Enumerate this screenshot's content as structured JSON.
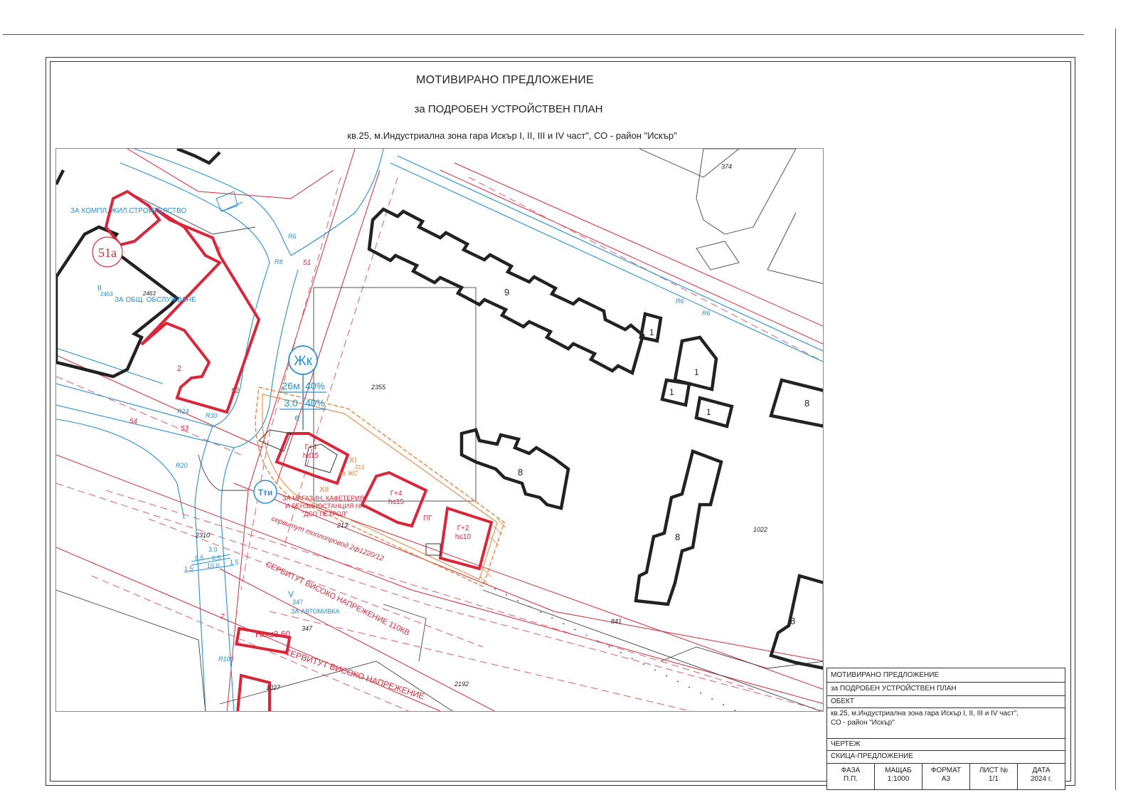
{
  "document": {
    "title": "МОТИВИРАНО ПРЕДЛОЖЕНИЕ",
    "subtitle": "за ПОДРОБЕН УСТРОЙСТВЕН ПЛАН",
    "location": "кв.25, м.Индустриална зона гара Искър I, II, III и IV част\", СО - район \"Искър\""
  },
  "map": {
    "zone_code": "Жк",
    "zone_height": "26м",
    "zone_density1": "40%",
    "zone_ratio": "3.0",
    "zone_density2": "40%",
    "zone_extra": "е",
    "tech_zone": "Тти",
    "quarter_number": "51а",
    "upi_purpose_construction": "ЗА КОМПЛ. ЖИЛ.СТРОИТЕЛСТВО",
    "upi_purpose_service": "ЗА ОБЩ. ОБСЛУЖВАНЕ",
    "upi_roman_2": "II",
    "upi_roman_2_ref": "2463",
    "upi_roman_5": "V",
    "upi_roman_5_ref": "347",
    "upi_purpose_carwash": "ЗА АВТОМИВКА",
    "upi_roman_11": "XI",
    "upi_roman_11_ref": "213",
    "upi_purpose_zhs": "за ЖС",
    "upi_roman_12": "XII",
    "shop_text_1": "ЗА МАГАЗИН, КАФЕТЕРИЯ",
    "shop_text_2": "И БЕНЗИНОСТАНЦИЯ НА",
    "shop_text_3": "\"ДСО ПЕТРОЛ\"",
    "servitude_heat": "сервитут топлопровод 2ф1220/12",
    "servitude_hv1": "СЕРВИТУТ ВИСОКО НАПРЕЖЕНИЕ 110КВ",
    "servitude_hv2": "СЕРВИТУТ ВИСОКО НАПРЕЖЕНИЕ",
    "height_limit": "Нкк≤3.60",
    "proposed_1_a": "Г+4",
    "proposed_1_b": "h≤15",
    "proposed_2_a": "Г+4",
    "proposed_2_b": "h≤15",
    "proposed_3_a": "Г+2",
    "proposed_3_b": "h≤10",
    "pg_label": "ПГ",
    "plot_2355": "2355",
    "plot_1022": "1022",
    "plot_841": "841",
    "plot_2192": "2192",
    "plot_2310": "2310",
    "plot_213": "213",
    "plot_347": "347",
    "plot_374": "374",
    "plot_1027": "1027",
    "plot_2463": "2463",
    "storeys_9": "9",
    "storeys_8a": "8",
    "storeys_8b": "8",
    "storeys_8c": "8",
    "storeys_8d": "8",
    "storeys_1a": "1",
    "storeys_2": "2",
    "num_51": "51",
    "num_52": "52",
    "num_53": "53",
    "num_54": "54",
    "num_2": "2",
    "radius_r6a": "R6",
    "radius_r6b": "R6",
    "radius_r6c": "R6",
    "radius_r8": "R8",
    "radius_r24": "R24",
    "radius_r30": "R30",
    "radius_r20": "R20",
    "radius_r100": "R100",
    "dim_30": "3.0",
    "dim_65a": "6.5",
    "dim_65b": "6.5",
    "dim_100": "10.0",
    "dim_15a": "1.5",
    "dim_15b": "1.5"
  },
  "stamp": {
    "title": "МОТИВИРАНО ПРЕДЛОЖЕНИЕ",
    "subtitle": "за ПОДРОБЕН УСТРОЙСТВЕН ПЛАН",
    "object_label": "ОБЕКТ",
    "object_line1": "кв.25, м.Индустриална зона гара Искър I, II, III и IV част\",",
    "object_line2": "СО - район \"Искър\"",
    "drawing_label": "ЧЕРТЕЖ",
    "drawing_value": "СКИЦА-ПРЕДЛОЖЕНИЕ",
    "cells": [
      {
        "label": "ФАЗА",
        "value": "П.П."
      },
      {
        "label": "МАЩАБ",
        "value": "1:1000"
      },
      {
        "label": "ФОРМАТ",
        "value": "А3"
      },
      {
        "label": "ЛИСТ №",
        "value": "1/1"
      },
      {
        "label": "ДАТА",
        "value": "2024 г."
      }
    ]
  },
  "colors": {
    "regulation": "#d42a3a",
    "regulation_dash": "#e0606a",
    "road_blue": "#2b8fd4",
    "building": "#222222",
    "proposed": "#d9263a",
    "upi_orange": "#e0803a"
  }
}
